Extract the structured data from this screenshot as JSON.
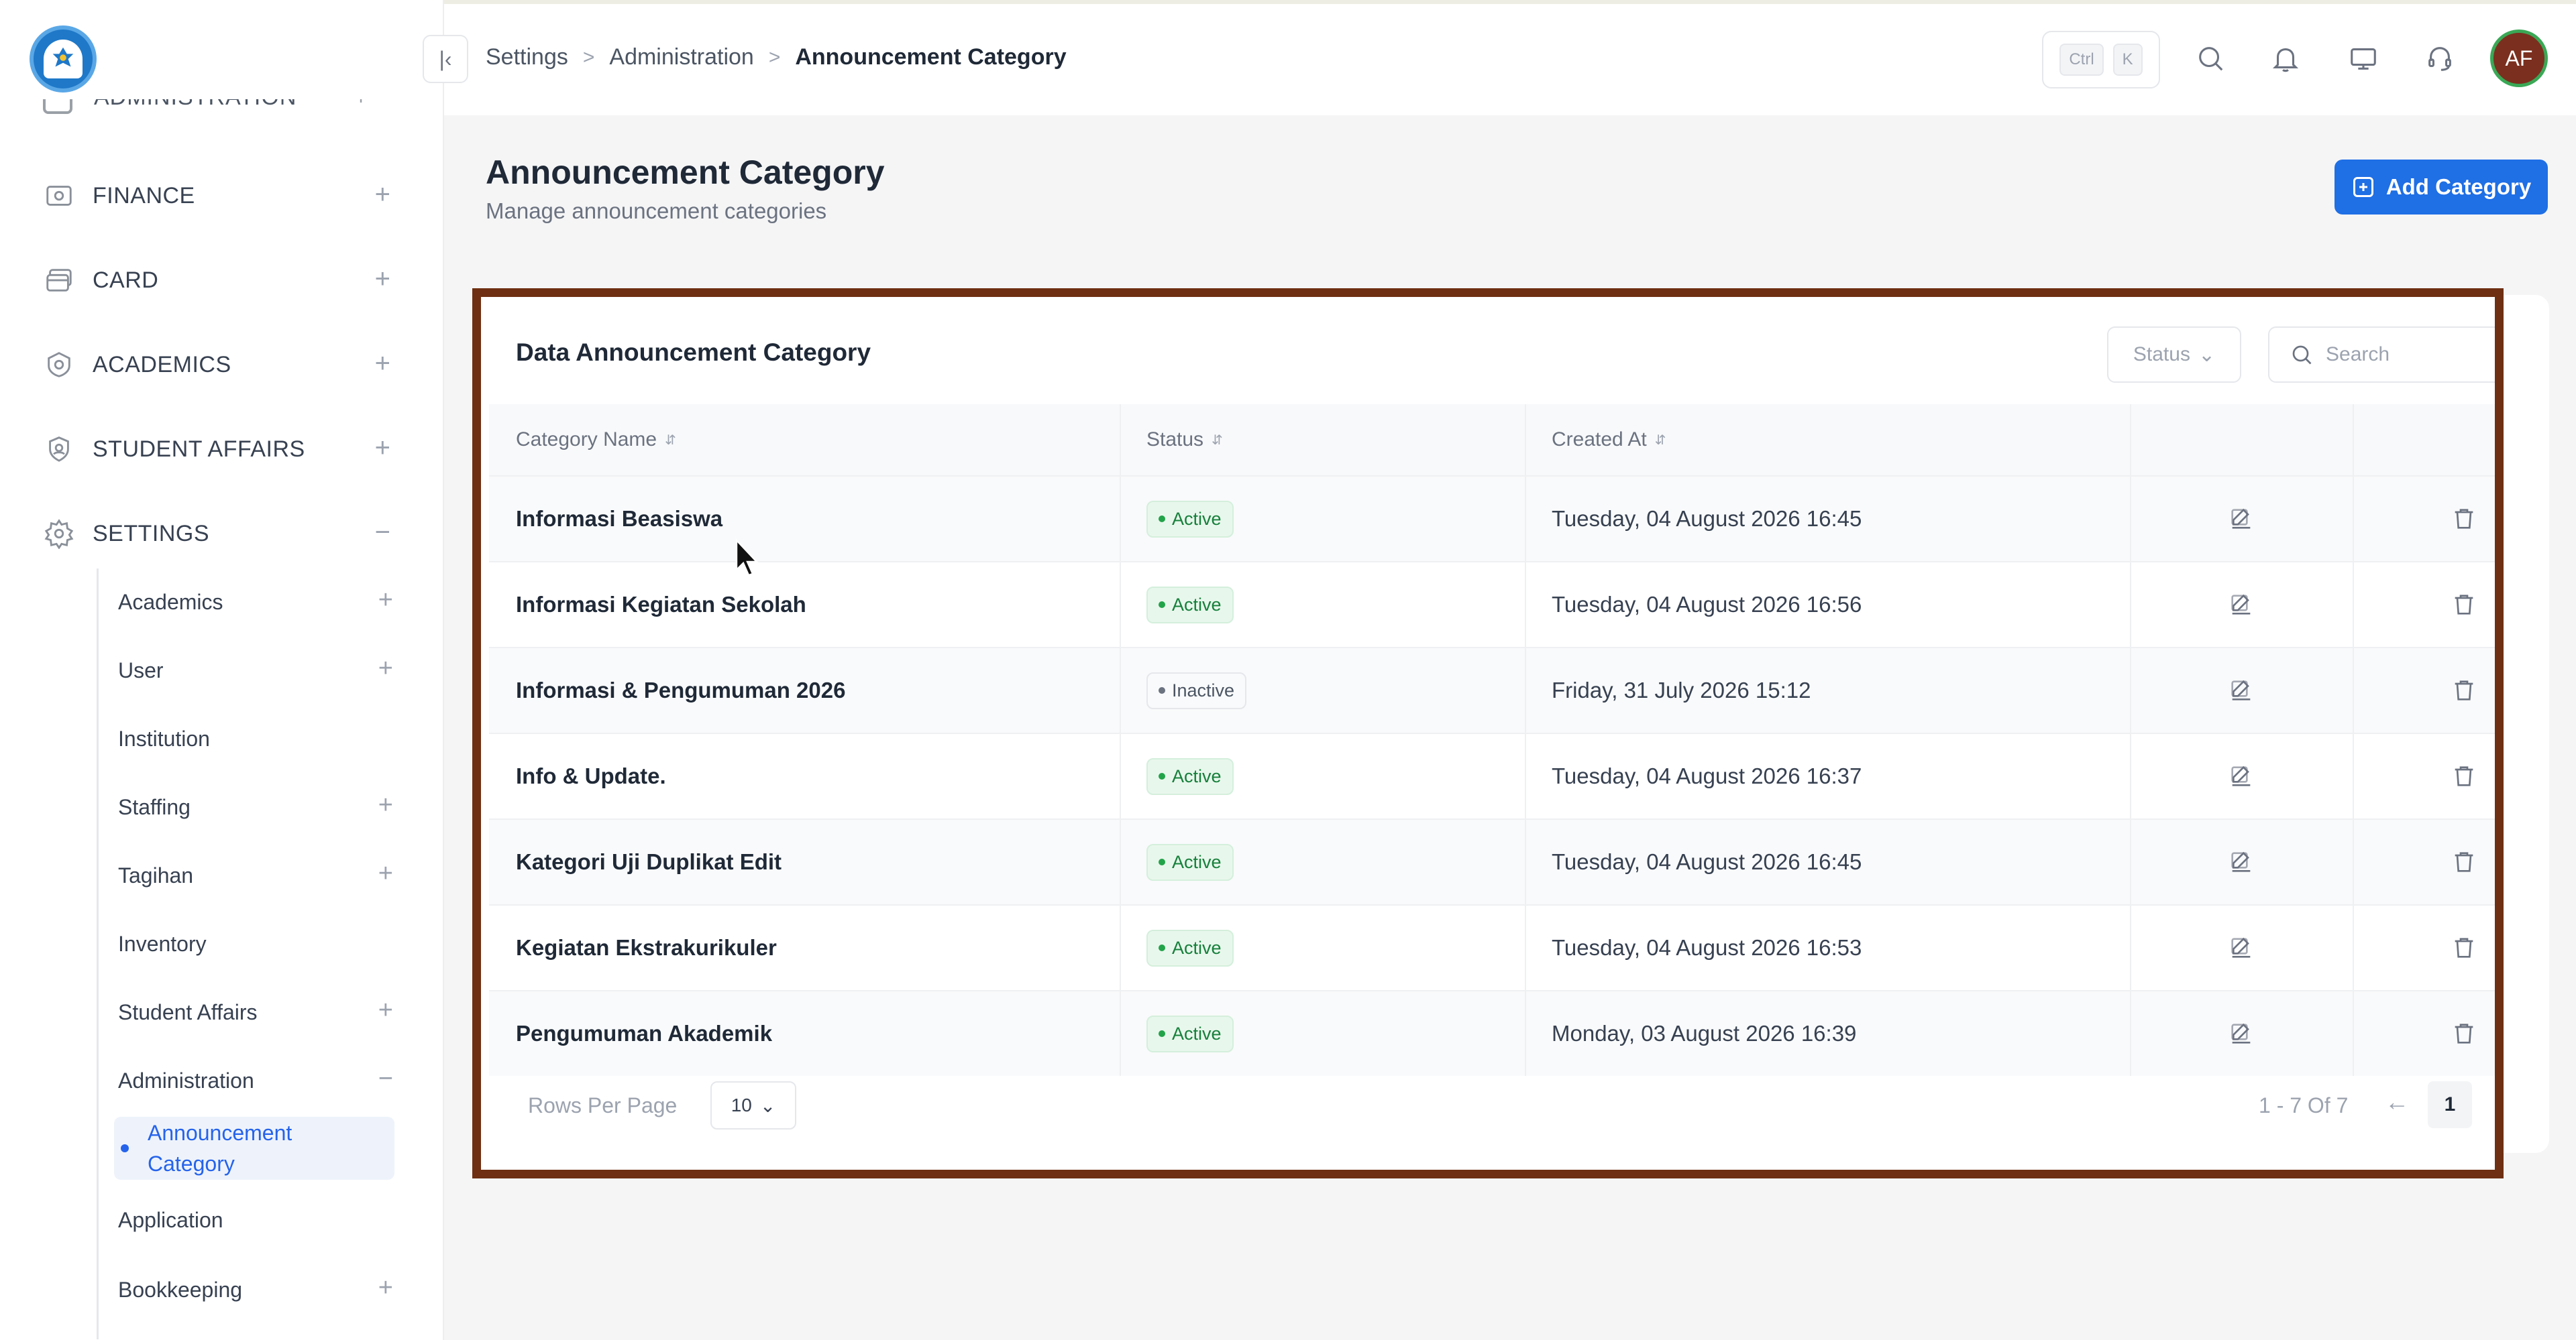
{
  "sidebar": {
    "cut_item": {
      "label": "ADMINISTRATION"
    },
    "menu": [
      {
        "label": "FINANCE",
        "toggle": "+",
        "icon": "finance-icon"
      },
      {
        "label": "CARD",
        "toggle": "+",
        "icon": "card-icon"
      },
      {
        "label": "ACADEMICS",
        "toggle": "+",
        "icon": "academics-icon"
      },
      {
        "label": "STUDENT AFFAIRS",
        "toggle": "+",
        "icon": "student-affairs-icon"
      },
      {
        "label": "SETTINGS",
        "toggle": "−",
        "icon": "gear-icon"
      }
    ],
    "submenu": [
      {
        "label": "Academics",
        "toggle": "+"
      },
      {
        "label": "User",
        "toggle": "+"
      },
      {
        "label": "Institution",
        "toggle": ""
      },
      {
        "label": "Staffing",
        "toggle": "+"
      },
      {
        "label": "Tagihan",
        "toggle": "+"
      },
      {
        "label": "Inventory",
        "toggle": ""
      },
      {
        "label": "Student Affairs",
        "toggle": "+"
      },
      {
        "label": "Administration",
        "toggle": "−"
      },
      {
        "label": "Application",
        "toggle": ""
      },
      {
        "label": "Bookkeeping",
        "toggle": "+"
      }
    ],
    "active_sub": "Announcement Category"
  },
  "header": {
    "breadcrumb": [
      "Settings",
      "Administration",
      "Announcement Category"
    ],
    "shortcut_keys": [
      "Ctrl",
      "K"
    ],
    "avatar_initials": "AF",
    "icons": [
      "search-icon",
      "bell-icon",
      "monitor-icon",
      "headset-icon"
    ]
  },
  "page": {
    "title": "Announcement Category",
    "subtitle": "Manage announcement categories",
    "add_button": "Add Category"
  },
  "table": {
    "title": "Data Announcement Category",
    "status_filter": "Status",
    "search_placeholder": "Search",
    "columns": [
      "Category Name",
      "Status",
      "Created At"
    ],
    "rows": [
      {
        "name": "Informasi Beasiswa",
        "status": "Active",
        "created": "Tuesday, 04 August 2026 16:45"
      },
      {
        "name": "Informasi Kegiatan Sekolah",
        "status": "Active",
        "created": "Tuesday, 04 August 2026 16:56"
      },
      {
        "name": "Informasi & Pengumuman 2026",
        "status": "Inactive",
        "created": "Friday, 31 July 2026 15:12"
      },
      {
        "name": "Info & Update.",
        "status": "Active",
        "created": "Tuesday, 04 August 2026 16:37"
      },
      {
        "name": "Kategori Uji Duplikat Edit",
        "status": "Active",
        "created": "Tuesday, 04 August 2026 16:45"
      },
      {
        "name": "Kegiatan Ekstrakurikuler",
        "status": "Active",
        "created": "Tuesday, 04 August 2026 16:53"
      },
      {
        "name": "Pengumuman Akademik",
        "status": "Active",
        "created": "Monday, 03 August 2026 16:39"
      }
    ],
    "rows_per_page_label": "Rows Per Page",
    "rows_per_page": "10",
    "pagination_info": "1 - 7 Of 7",
    "prev_arrow": "←",
    "current_page": "1"
  },
  "colors": {
    "accent": "#1f6fe5",
    "highlight_border": "#6e2f12",
    "active_badge": "#16803b",
    "avatar_bg": "#7b2f1e"
  }
}
